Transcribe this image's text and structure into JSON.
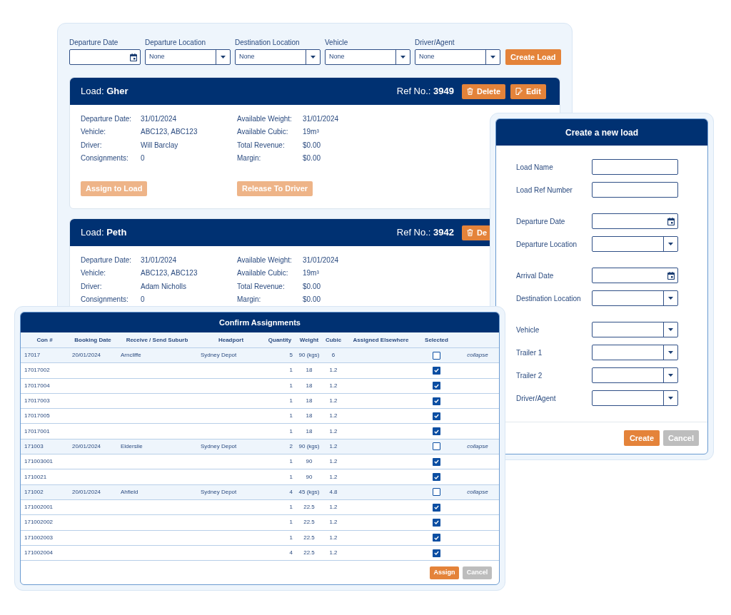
{
  "filters": {
    "fields": [
      {
        "kind": "date",
        "label": "Departure Date"
      },
      {
        "kind": "select",
        "label": "Departure Location",
        "value": "None"
      },
      {
        "kind": "select",
        "label": "Destination Location",
        "value": "None"
      },
      {
        "kind": "select",
        "label": "Vehicle",
        "value": "None"
      },
      {
        "kind": "select",
        "label": "Driver/Agent",
        "value": "None"
      }
    ],
    "create_button": "Create Load"
  },
  "loads": [
    {
      "title": "Load: **Gher**",
      "ref": "Ref No.: **3949**",
      "actions": [
        {
          "kind": "delete",
          "label": "Delete"
        },
        {
          "kind": "edit",
          "label": "Edit"
        }
      ],
      "details": [
        {
          "label": "Departure Date:",
          "value": "31/01/2024"
        },
        {
          "label": "Available Weight:",
          "value": "31/01/2024"
        },
        {
          "label": "Vehicle:",
          "value": "ABC123, ABC123"
        },
        {
          "label": "Available Cubic:",
          "value": "19m³"
        },
        {
          "label": "Driver:",
          "value": "Will Barclay"
        },
        {
          "label": "Total Revenue:",
          "value": "$0.00"
        },
        {
          "label": "Consignments:",
          "value": "0"
        },
        {
          "label": "Margin:",
          "value": "$0.00"
        }
      ],
      "buttons": [
        {
          "label": "Assign to Load",
          "disabled": true
        },
        {
          "label": "Release To Driver",
          "disabled": true
        }
      ]
    },
    {
      "title": "Load: **Peth**",
      "ref": "Ref No.: **3942**",
      "actions": [
        {
          "kind": "delete",
          "label": "De"
        }
      ],
      "details": [
        {
          "label": "Departure Date:",
          "value": "31/01/2024"
        },
        {
          "label": "Available Weight:",
          "value": "31/01/2024"
        },
        {
          "label": "Vehicle:",
          "value": "ABC123, ABC123"
        },
        {
          "label": "Available Cubic:",
          "value": "19m³"
        },
        {
          "label": "Driver:",
          "value": "Adam Nicholls"
        },
        {
          "label": "Total Revenue:",
          "value": "$0.00"
        },
        {
          "label": "Consignments:",
          "value": "0"
        },
        {
          "label": "Margin:",
          "value": "$0.00"
        }
      ]
    }
  ],
  "create_dialog": {
    "title": "Create a new load",
    "groups": [
      [
        {
          "kind": "text",
          "label": "Load Name"
        },
        {
          "kind": "text",
          "label": "Load Ref Number"
        }
      ],
      [
        {
          "kind": "date",
          "label": "Departure Date"
        },
        {
          "kind": "select",
          "label": "Departure Location"
        }
      ],
      [
        {
          "kind": "date",
          "label": "Arrival Date"
        },
        {
          "kind": "select",
          "label": "Destination Location"
        }
      ],
      [
        {
          "kind": "select",
          "label": "Vehicle"
        },
        {
          "kind": "select",
          "label": "Trailer 1"
        },
        {
          "kind": "select",
          "label": "Trailer 2"
        },
        {
          "kind": "select",
          "label": "Driver/Agent"
        }
      ]
    ],
    "buttons": [
      {
        "label": "Create",
        "disabled": false
      },
      {
        "label": "Cancel",
        "disabled": true
      }
    ]
  },
  "confirm_dialog": {
    "title": "Confirm Assignments",
    "columns": [
      "Con #",
      "Booking Date",
      "Receive / Send Suburb",
      "Headport",
      "Quantity",
      "Weight",
      "Cubic",
      "Assigned Elsewhere",
      "Selected"
    ],
    "rows": [
      {
        "kind": "group",
        "con": "17017",
        "booking_date": "20/01/2024",
        "suburb": "Arncliffe",
        "headport": "Sydney Depot",
        "quantity": "5",
        "weight": "90 (kgs)",
        "cubic": "6",
        "checked": false,
        "action": "collapse"
      },
      {
        "kind": "item",
        "con": "17017002",
        "quantity": "1",
        "weight": "18",
        "cubic": "1.2",
        "checked": true
      },
      {
        "kind": "item",
        "con": "17017004",
        "quantity": "1",
        "weight": "18",
        "cubic": "1.2",
        "checked": true
      },
      {
        "kind": "item",
        "con": "17017003",
        "quantity": "1",
        "weight": "18",
        "cubic": "1.2",
        "checked": true
      },
      {
        "kind": "item",
        "con": "17017005",
        "quantity": "1",
        "weight": "18",
        "cubic": "1.2",
        "checked": true
      },
      {
        "kind": "item",
        "con": "17017001",
        "quantity": "1",
        "weight": "18",
        "cubic": "1.2",
        "checked": true
      },
      {
        "kind": "group",
        "con": "171003",
        "booking_date": "20/01/2024",
        "suburb": "Elderslie",
        "headport": "Sydney Depot",
        "quantity": "2",
        "weight": "90 (kgs)",
        "cubic": "1.2",
        "checked": false,
        "action": "collapse"
      },
      {
        "kind": "item",
        "con": "171003001",
        "quantity": "1",
        "weight": "90",
        "cubic": "1.2",
        "checked": true
      },
      {
        "kind": "item",
        "con": "1710021",
        "quantity": "1",
        "weight": "90",
        "cubic": "1.2",
        "checked": true
      },
      {
        "kind": "group",
        "con": "171002",
        "booking_date": "20/01/2024",
        "suburb": "Ahfield",
        "headport": "Sydney Depot",
        "quantity": "4",
        "weight": "45 (kgs)",
        "cubic": "4.8",
        "checked": false,
        "action": "collapse"
      },
      {
        "kind": "item",
        "con": "171002001",
        "quantity": "1",
        "weight": "22.5",
        "cubic": "1.2",
        "checked": true
      },
      {
        "kind": "item",
        "con": "171002002",
        "quantity": "1",
        "weight": "22.5",
        "cubic": "1.2",
        "checked": true
      },
      {
        "kind": "item",
        "con": "171002003",
        "quantity": "1",
        "weight": "22.5",
        "cubic": "1.2",
        "checked": true
      },
      {
        "kind": "item",
        "con": "171002004",
        "quantity": "4",
        "weight": "22.5",
        "cubic": "1.2",
        "checked": true
      }
    ],
    "buttons": [
      {
        "label": "Assign",
        "disabled": false
      },
      {
        "label": "Cancel",
        "disabled": true
      }
    ]
  }
}
